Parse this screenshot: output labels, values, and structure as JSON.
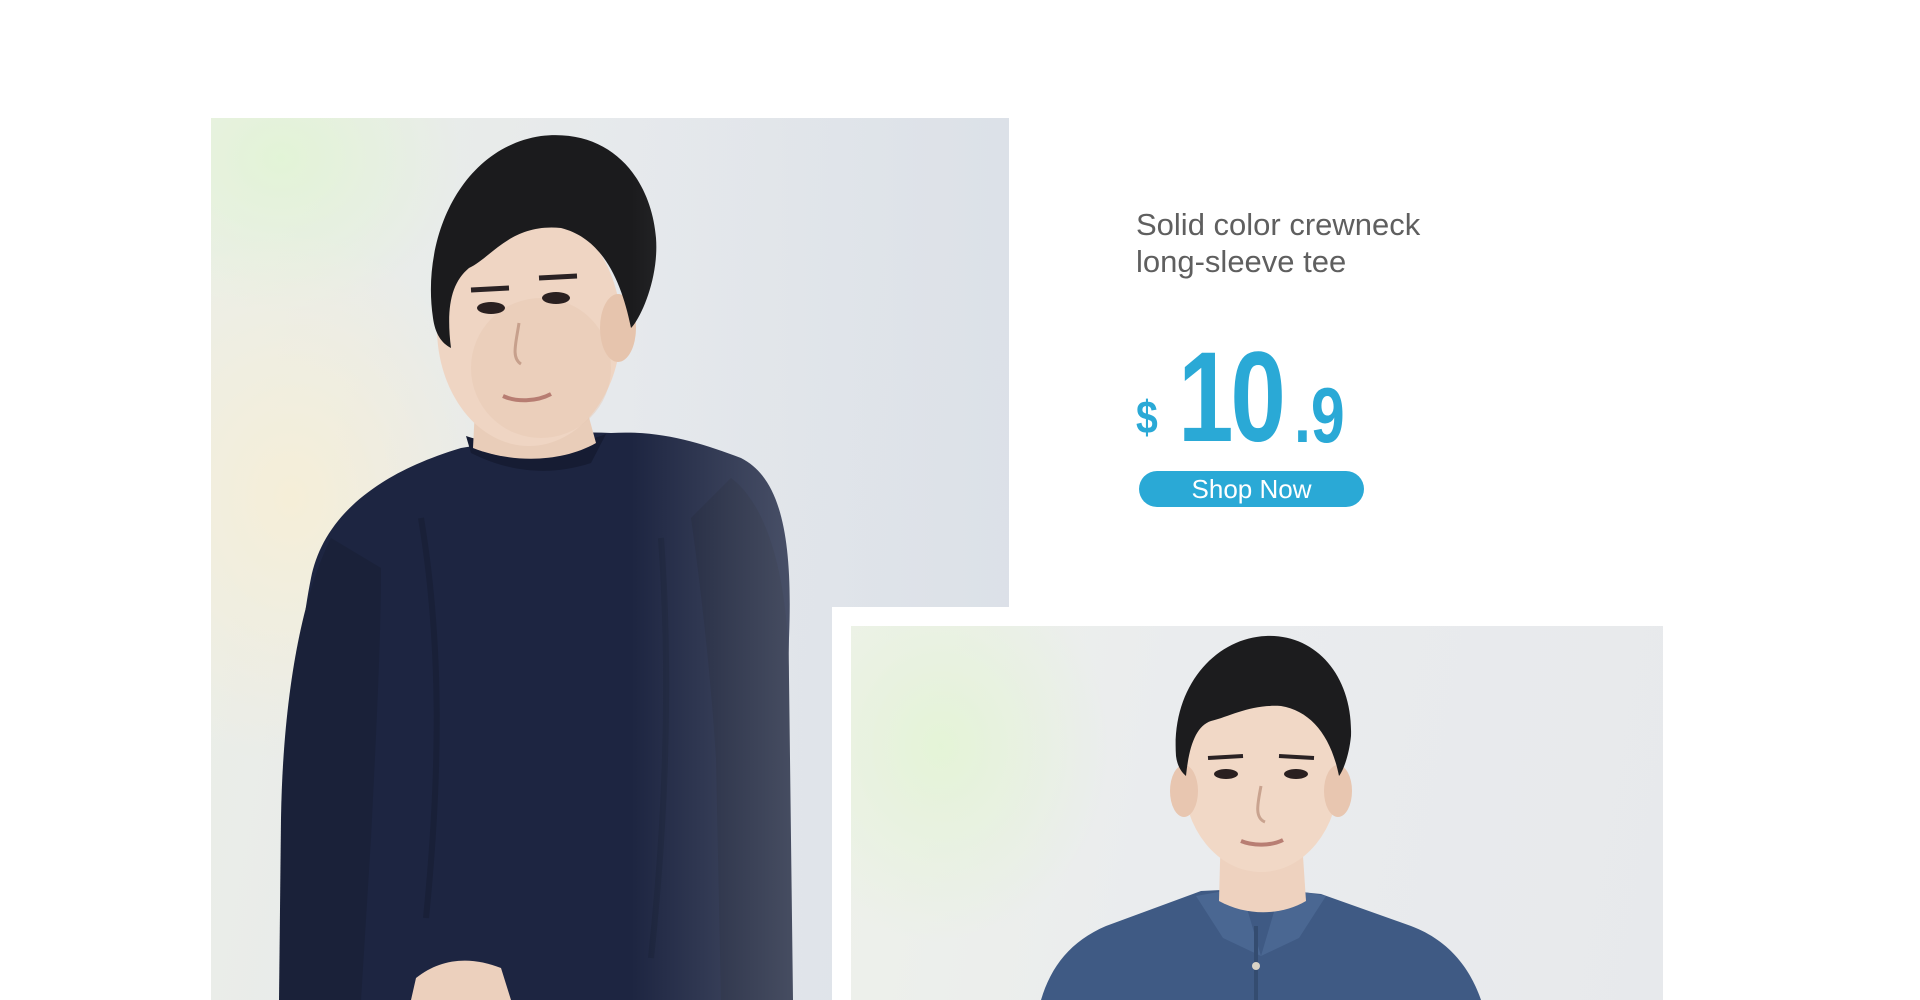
{
  "product": {
    "title_line1": "Solid color crewneck",
    "title_line2": "long-sleeve tee",
    "price": {
      "currency": "$",
      "integer": "10",
      "decimal": ".9"
    },
    "cta_label": "Shop Now"
  },
  "images": {
    "left": {
      "icon": "model-photo",
      "garment_color": "#1d2541"
    },
    "right": {
      "icon": "model-photo",
      "garment_color": "#3f5a84"
    }
  },
  "colors": {
    "accent": "#2aa9d6",
    "title_text": "#5f5f5f",
    "background": "#ffffff"
  }
}
